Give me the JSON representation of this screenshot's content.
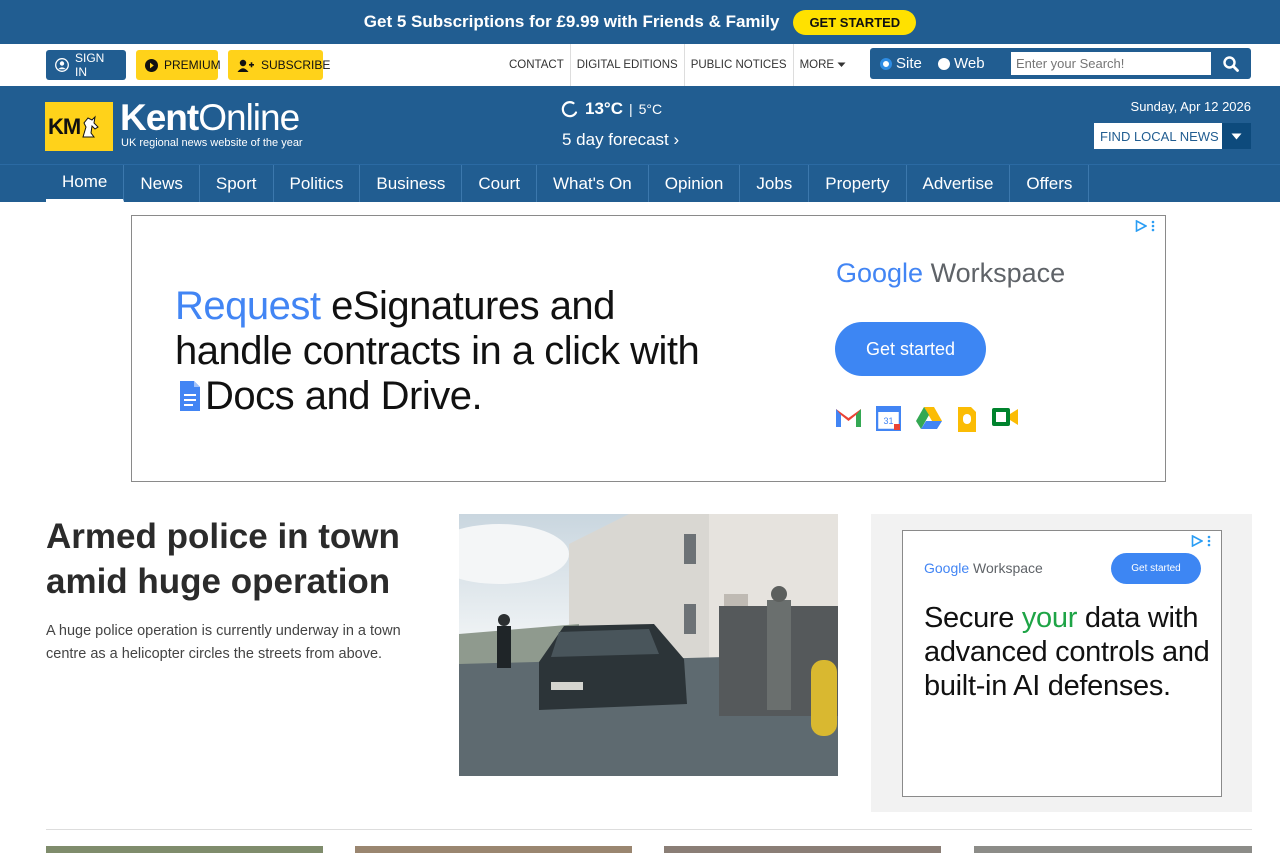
{
  "promo": {
    "text": "Get 5 Subscriptions for £9.99 with Friends & Family",
    "cta": "GET STARTED"
  },
  "util": {
    "signin": "SIGN IN",
    "premium": "PREMIUM",
    "subscribe": "SUBSCRIBE",
    "links": [
      "CONTACT",
      "DIGITAL EDITIONS",
      "PUBLIC NOTICES",
      "MORE"
    ],
    "search": {
      "site_label": "Site",
      "web_label": "Web",
      "placeholder": "Enter your Search!"
    }
  },
  "header": {
    "logo_mark": "KM",
    "logo_name_bold": "Kent",
    "logo_name_rest": "Online",
    "tagline": "UK regional news website of the year",
    "weather": {
      "high": "13°C",
      "separator": "|",
      "low": "5°C",
      "forecast": "5 day forecast ›"
    },
    "date": "Sunday, Apr 12 2026",
    "local_news": "FIND LOCAL NEWS"
  },
  "nav": [
    "Home",
    "News",
    "Sport",
    "Politics",
    "Business",
    "Court",
    "What's On",
    "Opinion",
    "Jobs",
    "Property",
    "Advertise",
    "Offers"
  ],
  "ad_top": {
    "headline_blue": "Request",
    "headline_rest": " eSignatures and handle contracts in a click with ",
    "headline_docs": "Docs and ",
    "headline_drive": "Drive.",
    "brand_google": "Google",
    "brand_product": " Workspace",
    "cta": "Get started"
  },
  "lead": {
    "title": "Armed police in town amid huge operation",
    "summary": "A huge police operation is currently underway in a town centre as a helicopter circles the streets from above."
  },
  "ad_side": {
    "brand_google": "Google",
    "brand_product": " Workspace",
    "cta": "Get started",
    "headline_a": "Secure ",
    "headline_green": "your",
    "headline_b": " data with advanced controls and built-in AI defenses."
  },
  "colors": {
    "brand_blue": "#215d91",
    "accent_yellow": "#ffd21a",
    "promo_button": "#ffe100",
    "google_blue": "#4285f4"
  }
}
